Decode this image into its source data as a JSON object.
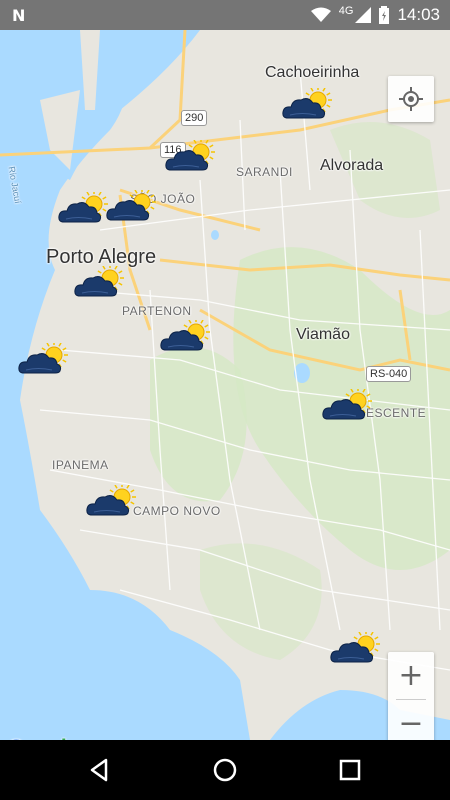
{
  "status": {
    "time": "14:03",
    "network": "4G",
    "notif_icon": "N"
  },
  "map": {
    "labels": {
      "cachoeirinha": "Cachoeirinha",
      "alvorada": "Alvorada",
      "sarandi": "SARANDI",
      "sao_joao": "SÃO JOÃO",
      "porto_alegre": "Porto Alegre",
      "partenon": "PARTENON",
      "viamao": "Viamão",
      "crescente": "ESCENTE",
      "ipanema": "IPANEMA",
      "campo_novo": "CAMPO NOVO",
      "rio_jacui": "Rio Jacuí"
    },
    "shields": {
      "r290": "290",
      "r116": "116",
      "rs040": "RS-040"
    },
    "weather_icons": "partly-cloudy-icon"
  },
  "controls": {
    "zoom_in": "+",
    "zoom_out": "−"
  },
  "attribution": {
    "google": [
      "G",
      "o",
      "o",
      "g",
      "l",
      "e"
    ]
  },
  "colors": {
    "water": "#aadaff",
    "land": "#e8e6df",
    "park": "#c8e3b5",
    "road_major": "#fbd27a",
    "status_bar": "#757575"
  }
}
